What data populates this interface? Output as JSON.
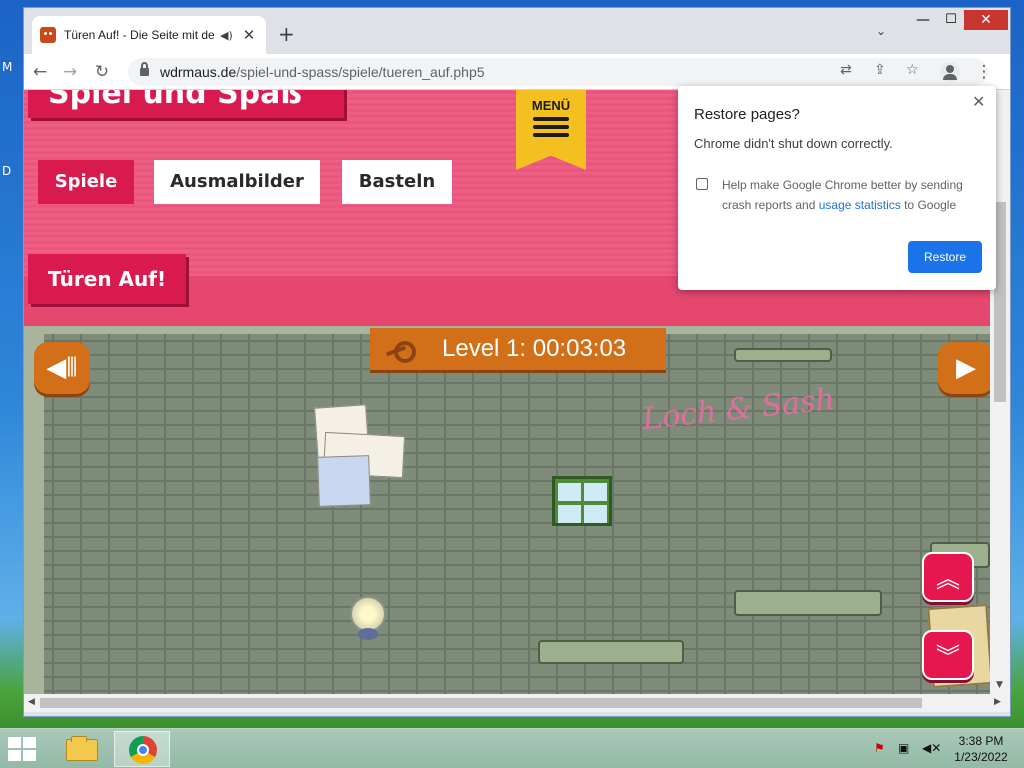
{
  "desktop": {
    "glyphs": [
      "M",
      "D"
    ]
  },
  "browser": {
    "tab": {
      "title": "Türen Auf! - Die Seite mit de",
      "audio_icon": "speaker-icon",
      "close_icon": "close-icon"
    },
    "new_tab_icon": "plus-icon",
    "tab_search_icon": "chevron-down-icon",
    "window_controls": {
      "minimize": "—",
      "maximize": "☐",
      "close": "✕"
    },
    "toolbar": {
      "back_icon": "←",
      "forward_icon": "→",
      "reload_icon": "↻",
      "url_host": "wdrmaus.de",
      "url_path": "/spiel-und-spass/spiele/tueren_auf.php5",
      "translate_icon": "translate-icon",
      "share_icon": "share-icon",
      "bookmark_icon": "☆",
      "menu_icon": "⋮"
    }
  },
  "page": {
    "brand_title": "Spiel und Spaß",
    "menu_label": "MENÜ",
    "nav": [
      "Spiele",
      "Ausmalbilder",
      "Basteln"
    ],
    "sub_title": "Türen Auf!",
    "game": {
      "level_label": "Level 1: 00:03:03",
      "graffiti": "Loch & Sash",
      "sound_icon": "speaker-mute-icon",
      "play_icon": "play-icon",
      "up_icon": "double-chevron-up-icon",
      "down_icon": "double-chevron-down-icon"
    }
  },
  "popup": {
    "title": "Restore pages?",
    "message": "Chrome didn't shut down correctly.",
    "checkbox_text_before": "Help make Google Chrome better by sending crash reports and ",
    "checkbox_link": "usage statistics",
    "checkbox_text_after": " to Google",
    "checkbox_checked": false,
    "restore_label": "Restore"
  },
  "taskbar": {
    "time": "3:38 PM",
    "date": "1/23/2022",
    "apps": [
      "file-explorer",
      "google-chrome"
    ]
  },
  "colors": {
    "header_pink": "#e9557d",
    "brand_red": "#d91a4f",
    "game_orange": "#d2701a",
    "menu_yellow": "#f4c020",
    "chrome_blue": "#1a73e8"
  }
}
